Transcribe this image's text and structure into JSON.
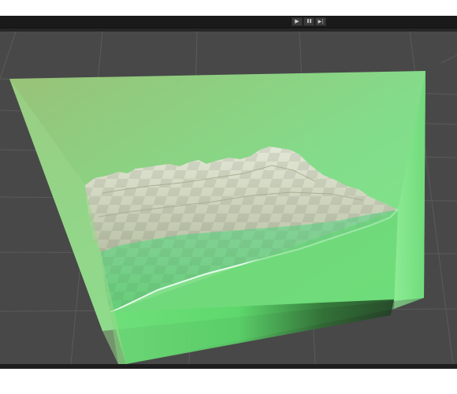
{
  "window": {
    "toolbar_bg": "#1a1a1a",
    "viewport_bg": "#484848",
    "grid_color": "#5a5a5a"
  },
  "playback": {
    "play_icon": "play-icon",
    "pause_icon": "pause-icon",
    "step_icon": "step-icon",
    "play_glyph": "▶",
    "pause_glyph": "❚❚",
    "step_glyph": "▶|"
  },
  "scene": {
    "objects": [
      {
        "name": "green-volume",
        "color": "#7de88a"
      },
      {
        "name": "terrain-mesh",
        "color": "#d8dccb"
      },
      {
        "name": "water-surface",
        "color": "#7fc9a0"
      },
      {
        "name": "shoreline-foam",
        "color": "#f0fff4"
      }
    ]
  }
}
